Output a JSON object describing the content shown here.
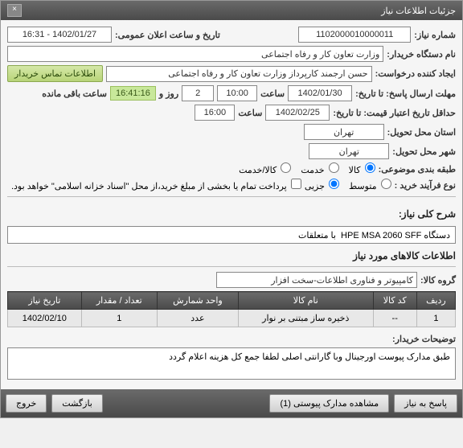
{
  "window": {
    "title": "جزئیات اطلاعات نیاز",
    "close": "×"
  },
  "fields": {
    "need_number_label": "شماره نیاز:",
    "need_number": "1102000010000011",
    "announce_date_label": "تاریخ و ساعت اعلان عمومی:",
    "announce_date": "1402/01/27 - 16:31",
    "buyer_name_label": "نام دستگاه خریدار:",
    "buyer_name": "وزارت تعاون کار و رفاه اجتماعی",
    "requester_label": "ایجاد کننده درخواست:",
    "requester": "حسن ارجمند کارپرداز وزارت تعاون کار و رفاه اجتماعی",
    "contact_btn": "اطلاعات تماس خریدار",
    "deadline_label": "مهلت ارسال پاسخ: تا تاریخ:",
    "deadline_date": "1402/01/30",
    "hour_label": "ساعت",
    "deadline_hour": "10:00",
    "days_count": "2",
    "days_and": "روز و",
    "remaining_time": "16:41:16",
    "remaining_label": "ساعت باقی مانده",
    "validity_label": "حداقل تاریخ اعتبار قیمت: تا تاریخ:",
    "validity_date": "1402/02/25",
    "validity_hour": "16:00",
    "tx_city_label": "استان محل تحویل:",
    "tx_city": "تهران",
    "dlv_city_label": "شهر محل تحویل:",
    "dlv_city": "تهران",
    "category_label": "طبقه بندی موضوعی:",
    "cat_goods": "کالا",
    "cat_service": "خدمت",
    "cat_goods_service": "کالا/خدمت",
    "purchase_type_label": "نوع فرآیند خرید :",
    "pt_small": "متوسط",
    "pt_partial": "جزیی",
    "payment_note": "پرداخت تمام یا بخشی از مبلغ خرید،از محل \"اسناد خزانه اسلامی\" خواهد بود.",
    "summary_label": "شرح کلی نیاز:",
    "summary": "دستگاه HPE MSA 2060 SFF  با متعلقات",
    "items_header": "اطلاعات کالاهای مورد نیاز",
    "group_label": "گروه کالا:",
    "group": "کامپیوتر و فناوری اطلاعات-سخت افزار",
    "buyer_notes_label": "توضیحات خریدار:",
    "buyer_notes": "طبق مدارک پیوست اورجینال وبا گارانتی اصلی  لطفا جمع کل هزینه اعلام گردد"
  },
  "table": {
    "headers": {
      "row": "ردیف",
      "code": "کد کالا",
      "name": "نام کالا",
      "unit": "واحد شمارش",
      "qty": "تعداد / مقدار",
      "date": "تاریخ نیاز"
    },
    "rows": [
      {
        "row": "1",
        "code": "--",
        "name": "ذخیره ساز مبتنی بر نوار",
        "unit": "عدد",
        "qty": "1",
        "date": "1402/02/10"
      }
    ]
  },
  "buttons": {
    "reply": "پاسخ به نیاز",
    "attachments": "مشاهده مدارک پیوستی (1)",
    "back": "بازگشت",
    "exit": "خروج"
  }
}
